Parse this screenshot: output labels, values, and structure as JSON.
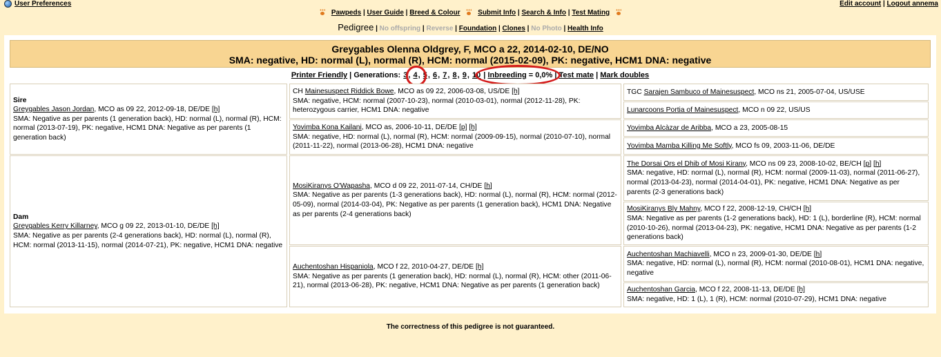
{
  "topbar": {
    "user_prefs": "User Preferences",
    "edit_account": "Edit account",
    "logout": "Logout annema"
  },
  "nav": {
    "pawpeds": "Pawpeds",
    "user_guide": "User Guide",
    "breed_colour": "Breed & Colour",
    "submit_info": "Submit Info",
    "search_info": "Search & Info",
    "test_mating": "Test Mating"
  },
  "subnav": {
    "pedigree": "Pedigree",
    "no_offspring": "No offspring",
    "reverse": "Reverse",
    "foundation": "Foundation",
    "clones": "Clones",
    "no_photo": "No Photo",
    "health_info": "Health Info"
  },
  "cat": {
    "title": "Greygables Olenna Oldgrey, F, MCO a 22, 2014-02-10, DE/NO",
    "health": "SMA: negative, HD: normal (L), normal (R), HCM: normal (2015-02-09), PK: negative, HCM1 DNA: negative"
  },
  "toolbar": {
    "printer_friendly": "Printer Friendly",
    "generations_label": "Generations:",
    "gens": [
      "3",
      "4",
      "5",
      "6",
      "7",
      "8",
      "9",
      "10"
    ],
    "inbreeding_link": "Inbreeding",
    "inbreeding_value": "= 0,0%",
    "test_mate": "Test mate",
    "mark_doubles": "Mark doubles"
  },
  "pedigree": {
    "sire": {
      "label": "Sire",
      "name": "Greygables Jason Jordan",
      "info": ", MCO as 09 22, 2012-09-18, DE/DE",
      "h": "[h]",
      "health": "SMA: Negative as per parents (1 generation back), HD: normal (L), normal (R), HCM: normal (2013-07-19), PK: negative, HCM1 DNA: Negative as per parents (1 generation back)"
    },
    "dam": {
      "label": "Dam",
      "name": "Greygables Kerry Killarney",
      "info": ", MCO g 09 22, 2013-01-10, DE/DE",
      "h": "[h]",
      "health": "SMA: Negative as per parents (2-4 generations back), HD: normal (L), normal (R), HCM: normal (2013-11-15), normal (2014-07-21), PK: negative, HCM1 DNA: negative"
    },
    "ss": {
      "prefix": "CH ",
      "name": "Mainesuspect Riddick Bowe",
      "info": ", MCO as 09 22, 2006-03-08, US/DE",
      "h": "[h]",
      "health": "SMA: negative, HCM: normal (2007-10-23), normal (2010-03-01), normal (2012-11-28), PK: heterozygous carrier, HCM1 DNA: negative"
    },
    "sd": {
      "name": "Yovimba Kona Kailani",
      "info": ", MCO as, 2006-10-11, DE/DE",
      "p": "[p]",
      "h": "[h]",
      "health": "SMA: negative, HD: normal (L), normal (R), HCM: normal (2009-09-15), normal (2010-07-10), normal (2011-11-22), normal (2013-06-28), HCM1 DNA: negative"
    },
    "ds": {
      "name": "MosiKiranys O'Wapasha",
      "info": ", MCO d 09 22, 2011-07-14, CH/DE",
      "h": "[h]",
      "health": "SMA: Negative as per parents (1-3 generations back), HD: normal (L), normal (R), HCM: normal (2012-05-09), normal (2014-03-04), PK: Negative as per parents (1 generation back), HCM1 DNA: Negative as per parents (2-4 generations back)"
    },
    "dd": {
      "name": "Auchentoshan Hispaniola",
      "info": ", MCO f 22, 2010-04-27, DE/DE",
      "h": "[h]",
      "health": "SMA: Negative as per parents (1 generation back), HD: normal (L), normal (R), HCM: other (2011-06-21), normal (2013-06-28), PK: negative, HCM1 DNA: Negative as per parents (1 generation back)"
    },
    "sss": {
      "prefix": "TGC ",
      "name": "Sarajen Sambuco of Mainesuspect",
      "info": ", MCO ns 21, 2005-07-04, US/USE"
    },
    "ssd": {
      "name": "Lunarcoons Portia of Mainesuspect",
      "info": ", MCO n 09 22, US/US"
    },
    "sds": {
      "name": "Yovimba Alcàzar de Aribba",
      "info": ", MCO a 23, 2005-08-15"
    },
    "sdd": {
      "name": "Yovimba Mamba Killing Me Softly",
      "info": ", MCO fs 09, 2003-11-06, DE/DE"
    },
    "dss": {
      "name": "The Dorsai Ors el Dhib of Mosi Kirany",
      "info": ", MCO ns 09 23, 2008-10-02, BE/CH",
      "p": "[p]",
      "h": "[h]",
      "health": "SMA: negative, HD: normal (L), normal (R), HCM: normal (2009-11-03), normal (2011-06-27), normal (2013-04-23), normal (2014-04-01), PK: negative, HCM1 DNA: Negative as per parents (2-3 generations back)"
    },
    "dsd": {
      "name": "MosiKiranys Bly Mahny",
      "info": ", MCO f 22, 2008-12-19, CH/CH",
      "h": "[h]",
      "health": "SMA: Negative as per parents (1-2 generations back), HD: 1 (L), borderline (R), HCM: normal (2010-10-26), normal (2013-04-23), PK: negative, HCM1 DNA: Negative as per parents (1-2 generations back)"
    },
    "dds": {
      "name": "Auchentoshan Machiavelli",
      "info": ", MCO n 23, 2009-01-30, DE/DE",
      "h": "[h]",
      "health": "SMA: negative, HD: normal (L), normal (R), HCM: normal (2010-08-01), HCM1 DNA: negative, negative"
    },
    "ddd": {
      "name": "Auchentoshan Garcia",
      "info": ", MCO f 22, 2008-11-13, DE/DE",
      "h": "[h]",
      "health": "SMA: negative, HD: 1 (L), 1 (R), HCM: normal (2010-07-29), HCM1 DNA: negative"
    }
  },
  "footer": "The correctness of this pedigree is not guaranteed."
}
